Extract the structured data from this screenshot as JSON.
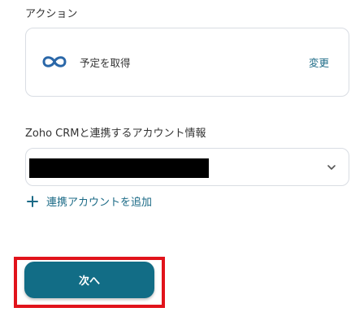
{
  "action_section": {
    "label": "アクション",
    "action_name": "予定を取得",
    "change_label": "変更",
    "icon": "zoho-crm-icon"
  },
  "account_section": {
    "label": "Zoho CRMと連携するアカウント情報",
    "selected_value_redacted": true,
    "add_account_label": "連携アカウントを追加"
  },
  "footer": {
    "next_label": "次へ"
  },
  "colors": {
    "accent": "#1b6a86",
    "button": "#126d86",
    "highlight": "#e1131b",
    "border": "#d9dde3"
  }
}
